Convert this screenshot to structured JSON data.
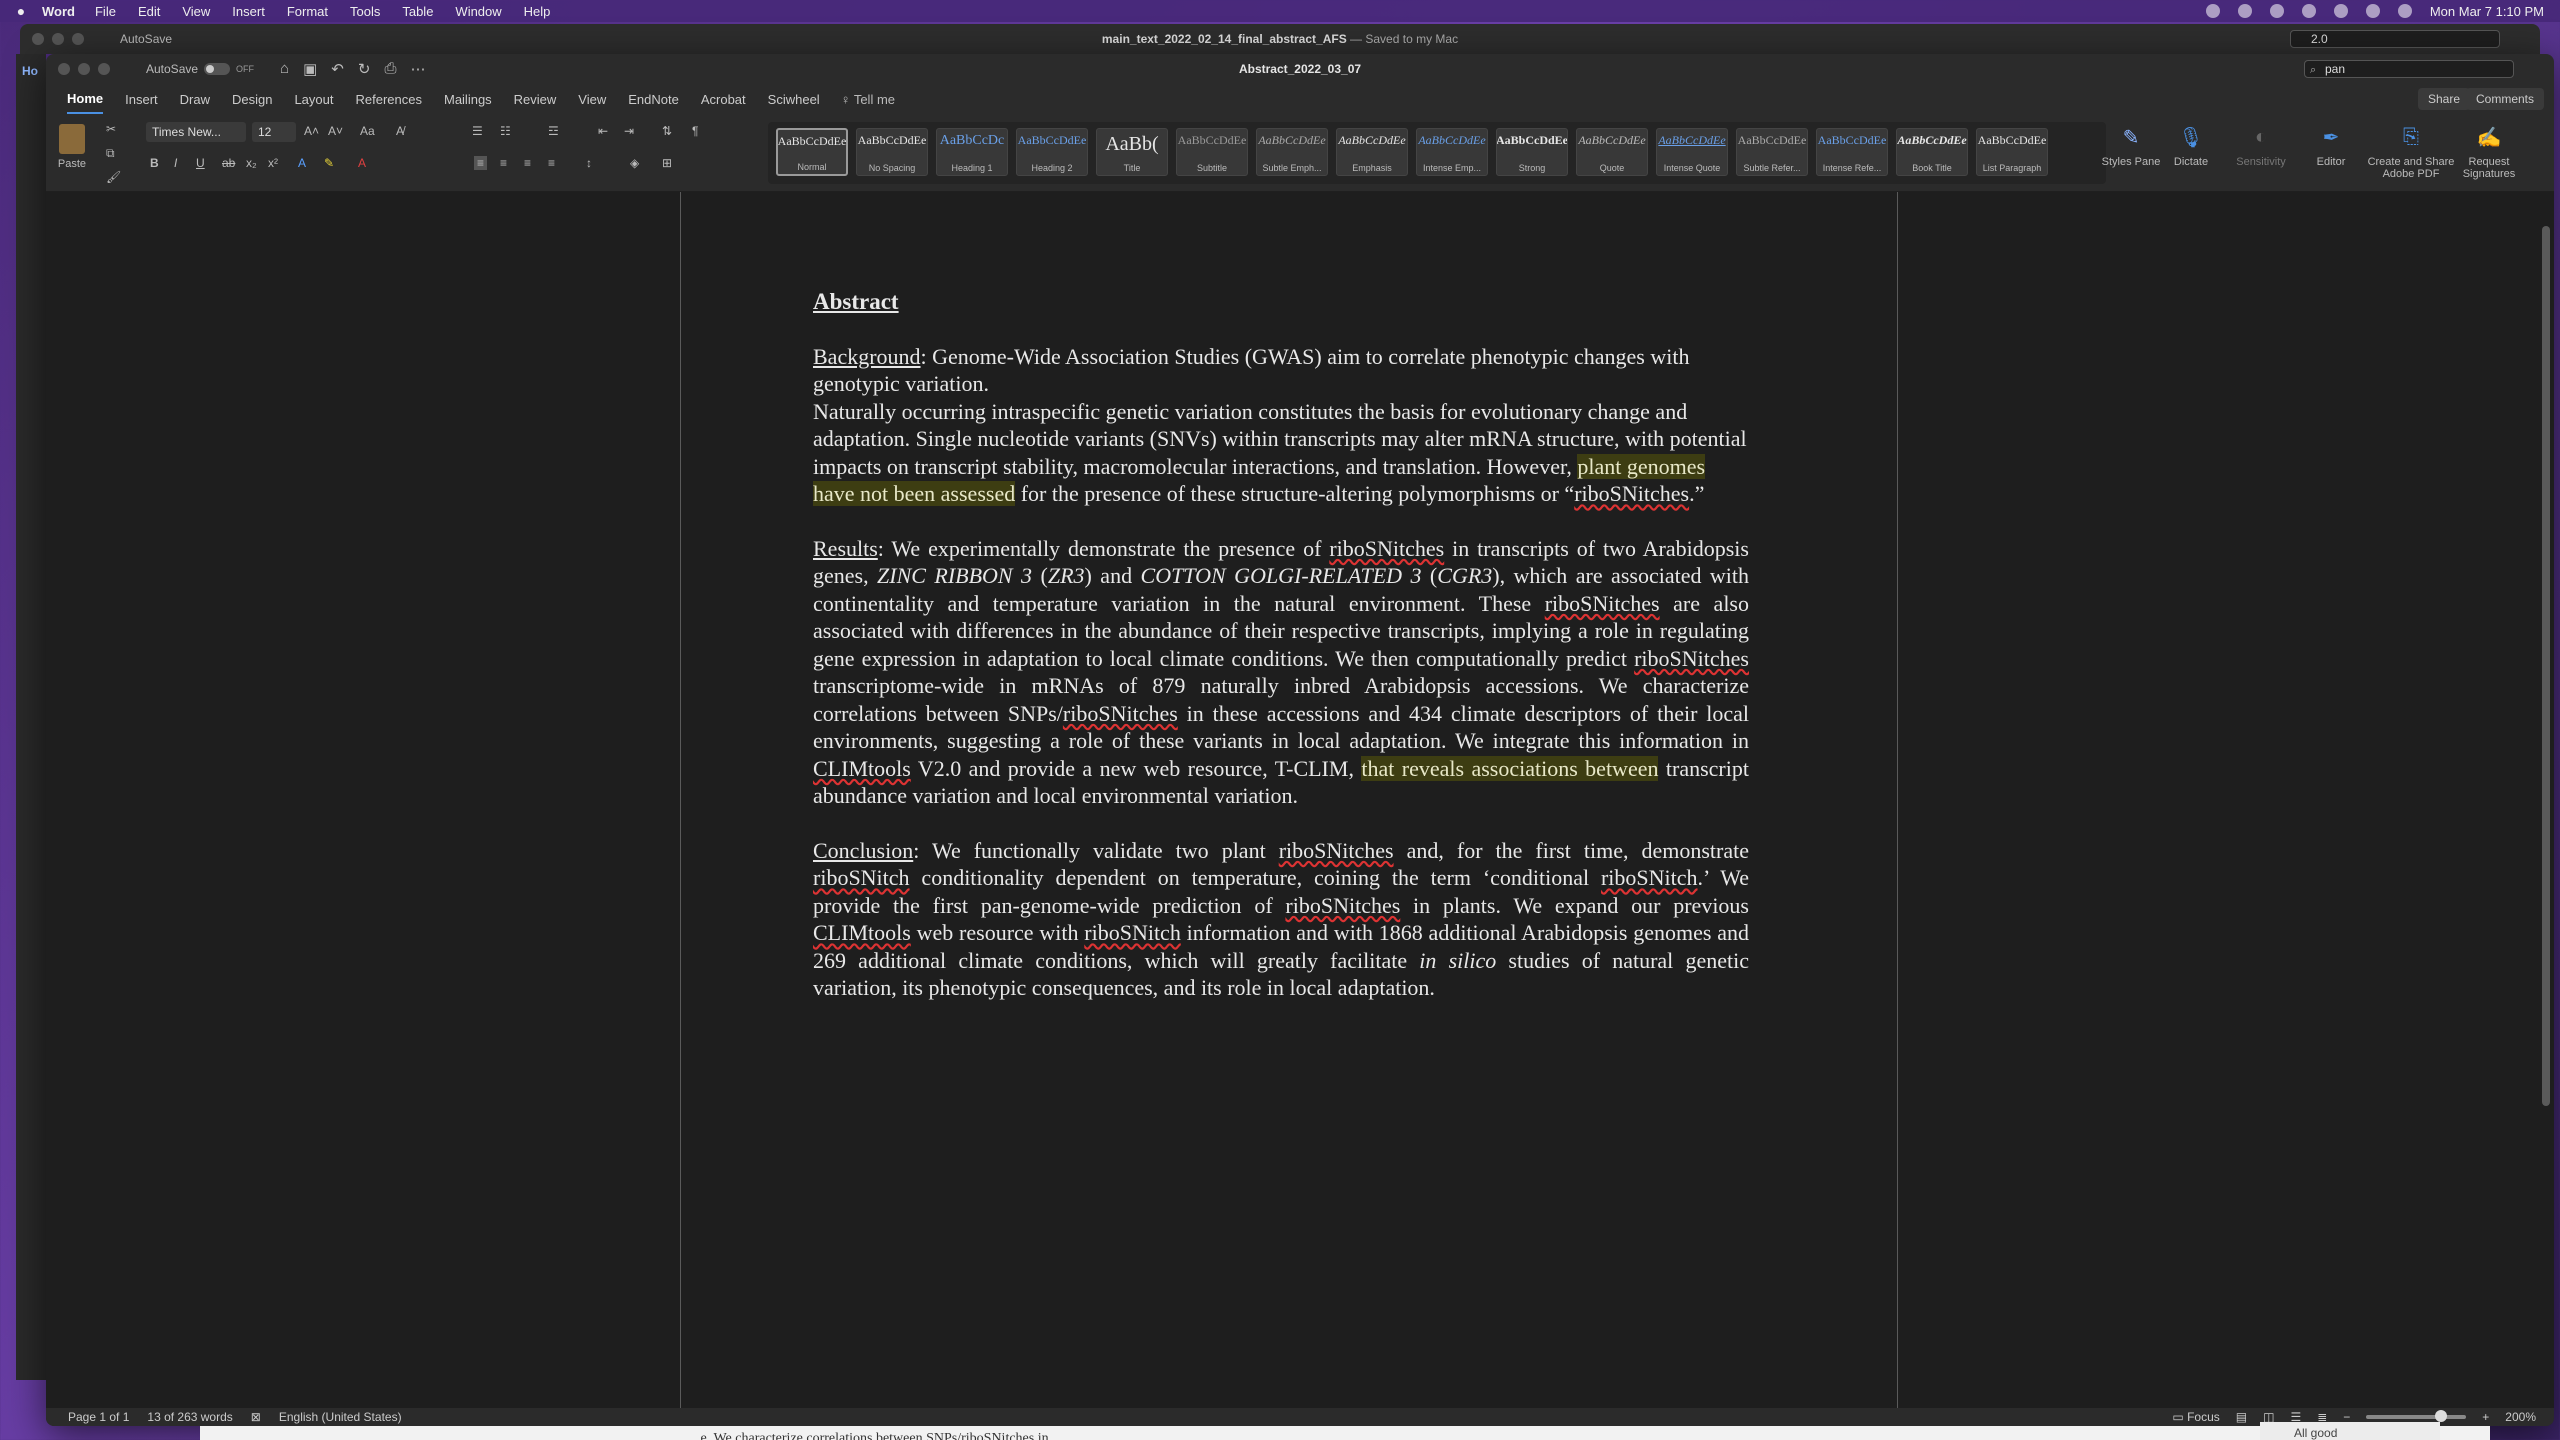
{
  "menubar": {
    "app": "Word",
    "items": [
      "File",
      "Edit",
      "View",
      "Insert",
      "Format",
      "Tools",
      "Table",
      "Window",
      "Help"
    ],
    "datetime": "Mon Mar 7  1:10 PM"
  },
  "bg_window": {
    "autosave": "AutoSave",
    "autosave_state": "OFF",
    "title": "main_text_2022_02_14_final_abstract_AFS",
    "title_suffix": "— Saved to my Mac",
    "search_value": "2.0",
    "left_tab": "Ho"
  },
  "window": {
    "autosave": "AutoSave",
    "autosave_state": "OFF",
    "title": "Abstract_2022_03_07",
    "search_value": "pan"
  },
  "tabs": [
    "Home",
    "Insert",
    "Draw",
    "Design",
    "Layout",
    "References",
    "Mailings",
    "Review",
    "View",
    "EndNote",
    "Acrobat",
    "Sciwheel"
  ],
  "tell_me": "Tell me",
  "share": "Share",
  "comments": "Comments",
  "ribbon": {
    "paste": "Paste",
    "font_name": "Times New...",
    "font_size": "12",
    "styles": [
      {
        "sample": "AaBbCcDdEe",
        "name": "Normal"
      },
      {
        "sample": "AaBbCcDdEe",
        "name": "No Spacing"
      },
      {
        "sample": "AaBbCcDc",
        "name": "Heading 1"
      },
      {
        "sample": "AaBbCcDdEe",
        "name": "Heading 2"
      },
      {
        "sample": "AaBb(",
        "name": "Title"
      },
      {
        "sample": "AaBbCcDdEe",
        "name": "Subtitle"
      },
      {
        "sample": "AaBbCcDdEe",
        "name": "Subtle Emph..."
      },
      {
        "sample": "AaBbCcDdEe",
        "name": "Emphasis"
      },
      {
        "sample": "AaBbCcDdEe",
        "name": "Intense Emp..."
      },
      {
        "sample": "AaBbCcDdEe",
        "name": "Strong"
      },
      {
        "sample": "AaBbCcDdEe",
        "name": "Quote"
      },
      {
        "sample": "AaBbCcDdEe",
        "name": "Intense Quote"
      },
      {
        "sample": "AaBbCcDdEe",
        "name": "Subtle Refer..."
      },
      {
        "sample": "AaBbCcDdEe",
        "name": "Intense Refe..."
      },
      {
        "sample": "AaBbCcDdEe",
        "name": "Book Title"
      },
      {
        "sample": "AaBbCcDdEe",
        "name": "List Paragraph"
      }
    ],
    "styles_pane": "Styles Pane",
    "dictate": "Dictate",
    "sensitivity": "Sensitivity",
    "editor": "Editor",
    "create_share": "Create and Share Adobe PDF",
    "request_signatures": "Request Signatures"
  },
  "document": {
    "heading": "Abstract",
    "background_label": "Background",
    "background_text": ": Genome-Wide Association Studies (GWAS) aim to correlate phenotypic changes with genotypic variation.",
    "p2_a": "Naturally occurring intraspecific genetic variation constitutes the basis for evolutionary change and adaptation. Single nucleotide variants (SNVs) within transcripts may alter mRNA structure, with potential impacts on transcript stability, macromolecular interactions, and translation. However, ",
    "p2_hl": "plant genomes have not been assessed",
    "p2_b": " for the presence of these structure-altering polymorphisms or “",
    "p2_sq": "riboSNitches",
    "p2_c": ".”",
    "results_label": "Results",
    "r1": ": We experimentally demonstrate the presence of ",
    "rsq1": "riboSNitches",
    "r2": " in transcripts of two Arabidopsis genes, ",
    "ri1": "ZINC RIBBON 3",
    "r3": " (",
    "ri2": "ZR3",
    "r4": ") and ",
    "ri3": "COTTON GOLGI-RELATED  3",
    "r5": " (",
    "ri4": "CGR3",
    "r6": "), which are associated with continentality and temperature variation in the natural environment. These ",
    "rsq2": "riboSNitches",
    "r7": " are also associated with differences in the abundance of their respective transcripts, implying a role in regulating gene expression in adaptation to local climate conditions. We then computationally predict ",
    "rsq3": "riboSNitches",
    "r8": " transcriptome-wide in mRNAs of 879 naturally inbred Arabidopsis accessions. We characterize correlations between SNPs/",
    "rsq4": "riboSNitches",
    "r9": " in these accessions and 434 climate descriptors of their local environments, suggesting a role of these variants in local adaptation. We integrate this information in ",
    "rsq5": "CLIMtools",
    "r10": " V2.0 and provide a new web resource, T-CLIM, ",
    "rhl": "that reveals associations between",
    "r11": " transcript abundance variation and local environmental variation.",
    "conclusion_label": "Conclusion",
    "c1": ": We functionally validate two plant ",
    "csq1": "riboSNitches",
    "c2": " and, for the first time, demonstrate ",
    "csq2": "riboSNitch",
    "c3": " conditionality dependent on temperature, coining the term ‘conditional ",
    "csq3": "riboSNitch",
    "c4": ".’ We provide the first pan-genome-wide prediction of ",
    "csq4": "riboSNitches",
    "c5": " in plants. We expand our previous ",
    "csq5": "CLIMtools",
    "c6": " web resource with ",
    "csq6": "riboSNitch",
    "c7": " information and with 1868 additional Arabidopsis genomes and 269 additional climate conditions, which will greatly facilitate ",
    "ci1": "in silico",
    "c8": " studies of natural genetic variation, its phenotypic consequences, and its role in local adaptation."
  },
  "status": {
    "page": "Page 1 of 1",
    "words": "13 of 263 words",
    "language": "English (United States)",
    "focus": "Focus",
    "zoom": "200%",
    "zoom_level": 0.75
  },
  "bottom_strip": {
    "text": "...e. We characterize correlations between SNPs/riboSNitches in...",
    "right": "All good"
  },
  "colors": {
    "highlight": "#3d3d12",
    "accent": "#4a90e2"
  }
}
